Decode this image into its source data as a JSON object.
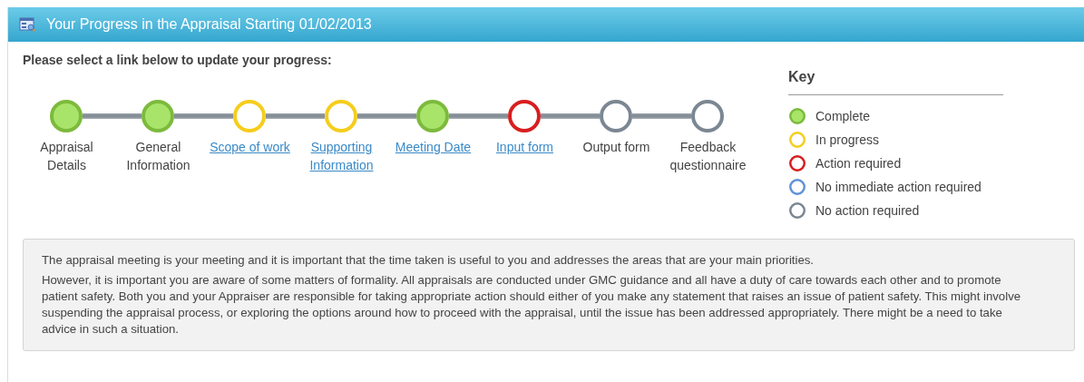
{
  "header": {
    "title": "Your Progress in the Appraisal Starting 01/02/2013"
  },
  "instruction": "Please select a link below to update your progress:",
  "steps": [
    {
      "label": "Appraisal Details",
      "kind": "complete",
      "link": false
    },
    {
      "label": "General Information",
      "kind": "complete",
      "link": false
    },
    {
      "label": "Scope of work",
      "kind": "in_progress",
      "link": true
    },
    {
      "label": "Supporting Information",
      "kind": "in_progress",
      "link": true
    },
    {
      "label": "Meeting Date",
      "kind": "complete",
      "link": true
    },
    {
      "label": "Input form",
      "kind": "action_required",
      "link": true
    },
    {
      "label": "Output form",
      "kind": "no_action",
      "link": false
    },
    {
      "label": "Feedback questionnaire",
      "kind": "no_action",
      "link": false
    }
  ],
  "key": {
    "title": "Key",
    "items": [
      {
        "label": "Complete",
        "kind": "complete"
      },
      {
        "label": "In progress",
        "kind": "in_progress"
      },
      {
        "label": "Action required",
        "kind": "action_required"
      },
      {
        "label": "No immediate action required",
        "kind": "no_immediate_action"
      },
      {
        "label": "No action required",
        "kind": "no_action"
      }
    ]
  },
  "notice": [
    "The appraisal meeting is your meeting and it is important that the time taken is useful to you and addresses the areas that are your main priorities.",
    "However, it is important you are aware of some matters of formality. All appraisals are conducted under GMC guidance and all have a duty of care towards each other and to promote patient safety. Both you and your Appraiser are responsible for taking appropriate action should either of you make any statement that raises an issue of patient safety. This might involve suspending the appraisal process, or exploring the options around how to proceed with the appraisal, until the issue has been addressed appropriately. There might be a need to take advice in such a situation."
  ]
}
